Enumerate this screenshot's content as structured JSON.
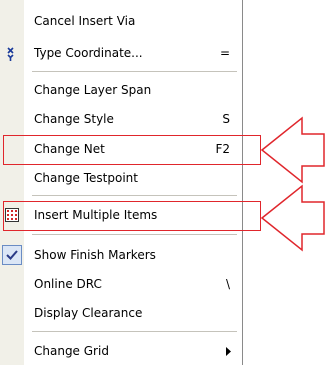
{
  "menu": {
    "items": [
      {
        "label": "Cancel Insert Via",
        "shortcut": ""
      },
      {
        "label": "Type Coordinate...",
        "shortcut": "=",
        "icon": "xy-coordinate-icon"
      },
      {
        "label": "Change Layer Span",
        "shortcut": ""
      },
      {
        "label": "Change Style",
        "shortcut": "S"
      },
      {
        "label": "Change Net",
        "shortcut": "F2"
      },
      {
        "label": "Change Testpoint",
        "shortcut": ""
      },
      {
        "label": "Insert Multiple Items",
        "shortcut": "",
        "icon": "grid-dots-icon"
      },
      {
        "label": "Show Finish Markers",
        "shortcut": "",
        "checked": true
      },
      {
        "label": "Online DRC",
        "shortcut": "\\"
      },
      {
        "label": "Display Clearance",
        "shortcut": ""
      },
      {
        "label": "Change Grid",
        "shortcut": "",
        "submenu": true
      }
    ]
  },
  "colors": {
    "highlight": "#e0262c",
    "gutter": "#f1f0e8",
    "check": "#2a3a86"
  }
}
